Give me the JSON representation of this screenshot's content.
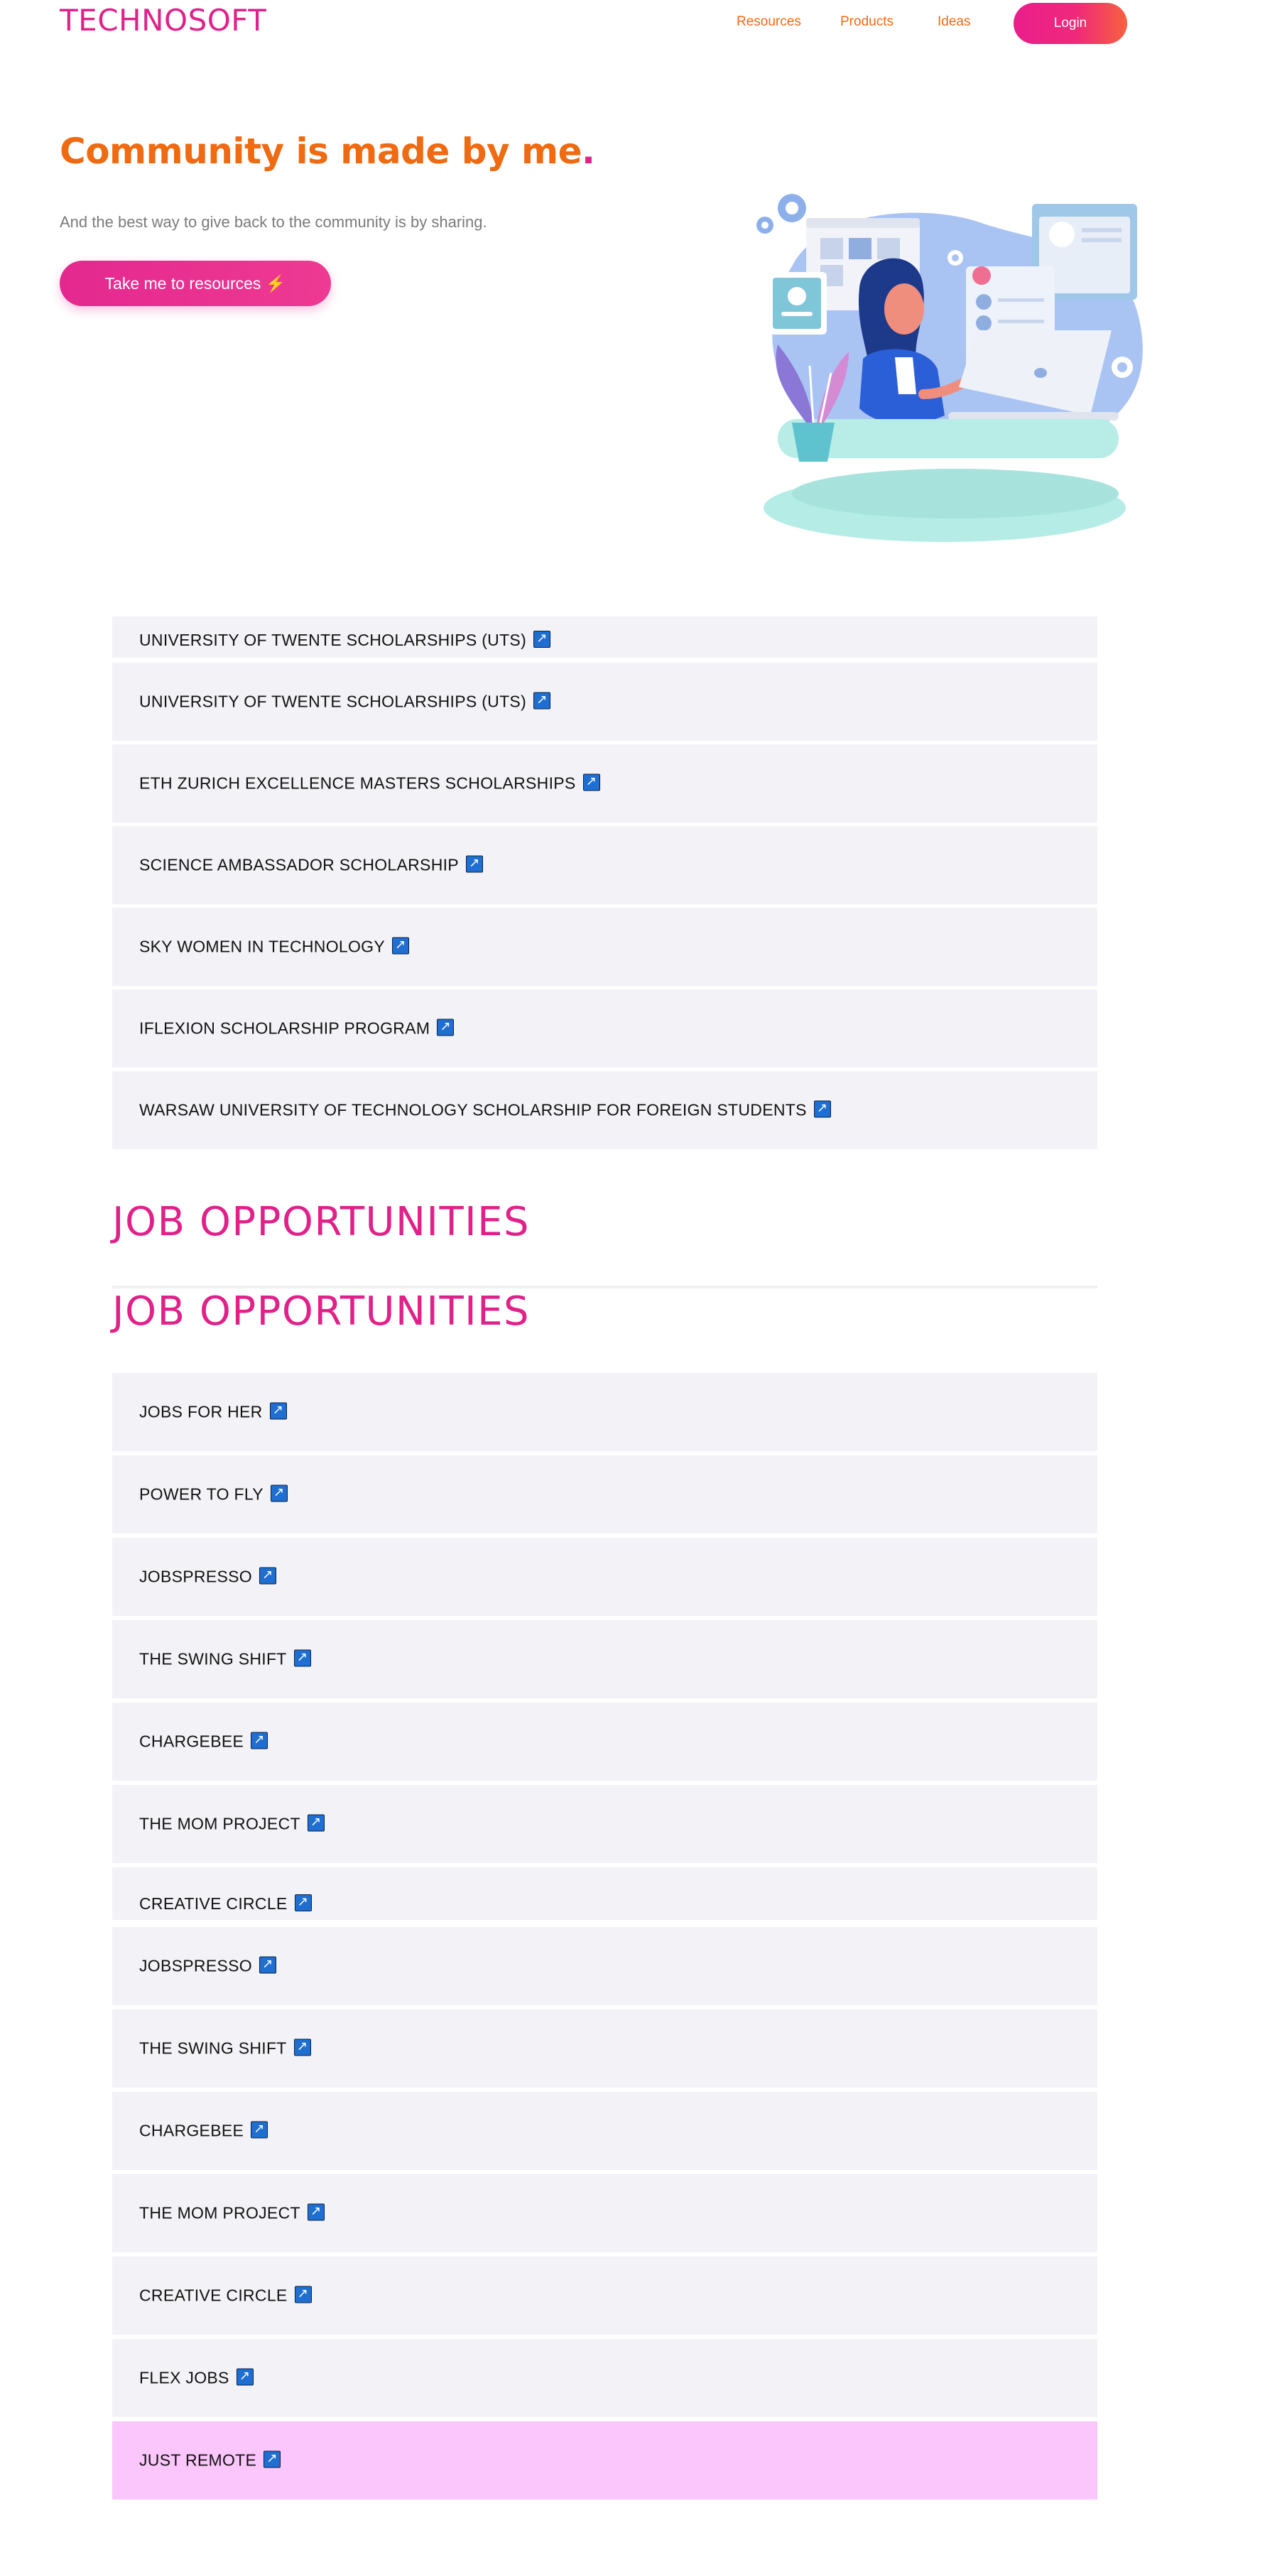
{
  "nav": {
    "brand": "TECHNOSOFT",
    "links": [
      "Resources",
      "Products",
      "Ideas"
    ],
    "login_label": "Login"
  },
  "hero": {
    "title": "Community is made by me",
    "title_dot": ".",
    "subtitle": "And the best way to give back to the community is by sharing.",
    "cta_label": "Take me to resources ⚡"
  },
  "scholarships": {
    "partial_label": "UNIVERSITY OF TWENTE SCHOLARSHIPS (UTS)",
    "items": [
      "UNIVERSITY OF TWENTE SCHOLARSHIPS (UTS)",
      "ETH ZURICH EXCELLENCE MASTERS SCHOLARSHIPS",
      "SCIENCE AMBASSADOR SCHOLARSHIP",
      "SKY WOMEN IN TECHNOLOGY",
      "IFLEXION SCHOLARSHIP PROGRAM",
      "WARSAW UNIVERSITY OF TECHNOLOGY SCHOLARSHIP FOR FOREIGN STUDENTS"
    ]
  },
  "jobs": {
    "heading_ghost": "JOB OPPORTUNITIES",
    "heading": "JOB OPPORTUNITIES",
    "items": [
      "JOBS FOR HER",
      "POWER TO FLY",
      "JOBSPRESSO",
      "THE SWING SHIFT",
      "CHARGEBEE",
      "THE MOM PROJECT",
      "CREATIVE CIRCLE"
    ],
    "items_repeat": [
      "JOBSPRESSO",
      "THE SWING SHIFT",
      "CHARGEBEE",
      "THE MOM PROJECT",
      "CREATIVE CIRCLE",
      "FLEX JOBS",
      "JUST REMOTE"
    ]
  },
  "colors": {
    "brand_pink": "#e0218a",
    "accent_orange": "#ef6a10",
    "row_bg": "#f3f3f7",
    "row_highlight": "#fbc6fb",
    "link_icon": "#1e6fd1"
  },
  "icons": {
    "external_link": "external-link-icon",
    "cta": "lightning-icon"
  }
}
